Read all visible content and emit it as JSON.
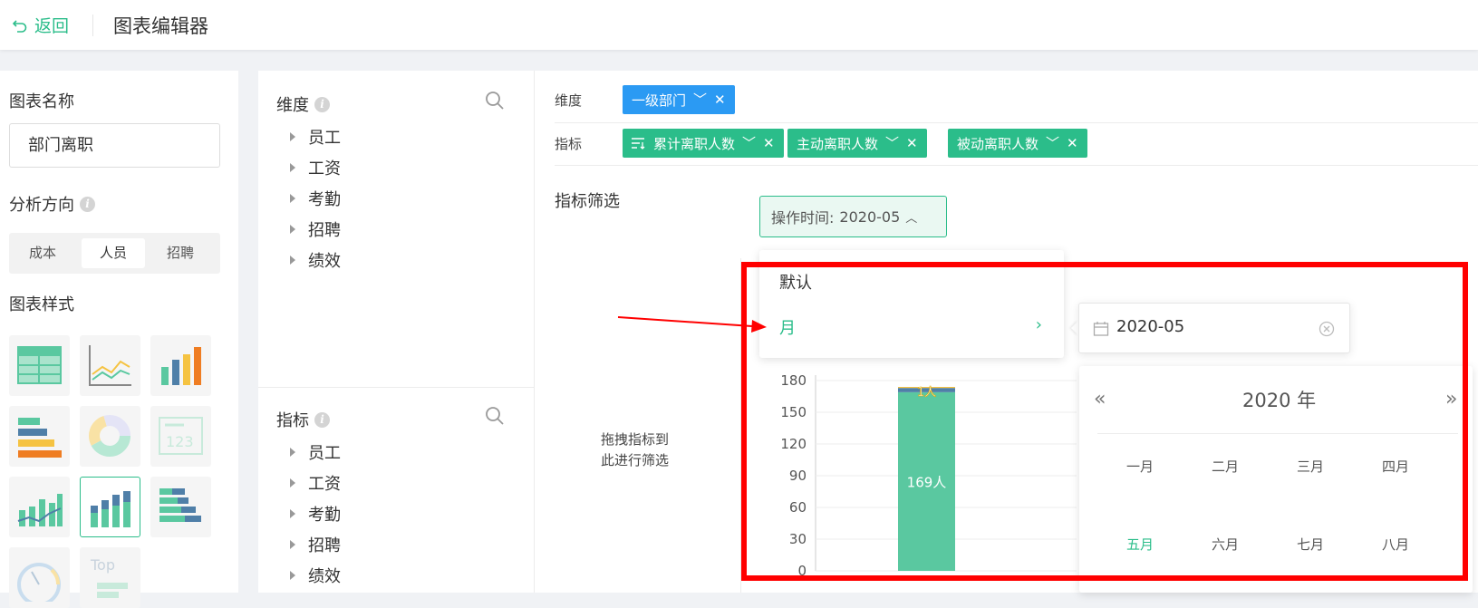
{
  "header": {
    "back_label": "返回",
    "title": "图表编辑器"
  },
  "left": {
    "chart_name_label": "图表名称",
    "chart_name_value": "部门离职",
    "direction_label": "分析方向",
    "directions": [
      "成本",
      "人员",
      "招聘"
    ],
    "style_label": "图表样式",
    "tile_topn_text": "Top"
  },
  "middle": {
    "dimension_label": "维度",
    "dimension_items": [
      "员工",
      "工资",
      "考勤",
      "招聘",
      "绩效"
    ],
    "metric_label": "指标",
    "metric_items": [
      "员工",
      "工资",
      "考勤",
      "招聘",
      "绩效"
    ]
  },
  "right": {
    "dimension_row_label": "维度",
    "dimension_tag": "一级部门",
    "metric_row_label": "指标",
    "metric_tags": [
      "累计离职人数",
      "主动离职人数",
      "被动离职人数"
    ],
    "filter_label": "指标筛选",
    "drop_hint_line1": "拖拽指标到",
    "drop_hint_line2": "此进行筛选",
    "op_time_label": "操作时间:",
    "op_time_value": "2020-05"
  },
  "dropdown": {
    "default_label": "默认",
    "month_label": "月"
  },
  "date_picker": {
    "value": "2020-05",
    "year_label": "2020 年",
    "months_visible": [
      "一月",
      "二月",
      "三月",
      "四月",
      "五月",
      "六月",
      "七月",
      "八月"
    ],
    "selected_month": "五月"
  },
  "chart_data": {
    "type": "bar",
    "yticks": [
      "180",
      "150",
      "120",
      "90",
      "60",
      "30",
      "0"
    ],
    "ylim": [
      0,
      180
    ],
    "series": [
      {
        "values": [
          169
        ],
        "label": "169人",
        "color": "#5ac8a0"
      },
      {
        "values": [
          4
        ],
        "color": "#4f7fa8"
      },
      {
        "values": [
          1
        ],
        "label": "1人",
        "color": "#f5c342"
      }
    ]
  },
  "colors": {
    "accent": "#2bbd8a",
    "blue_tag": "#2b9af3",
    "annotation_red": "#ff0000"
  }
}
